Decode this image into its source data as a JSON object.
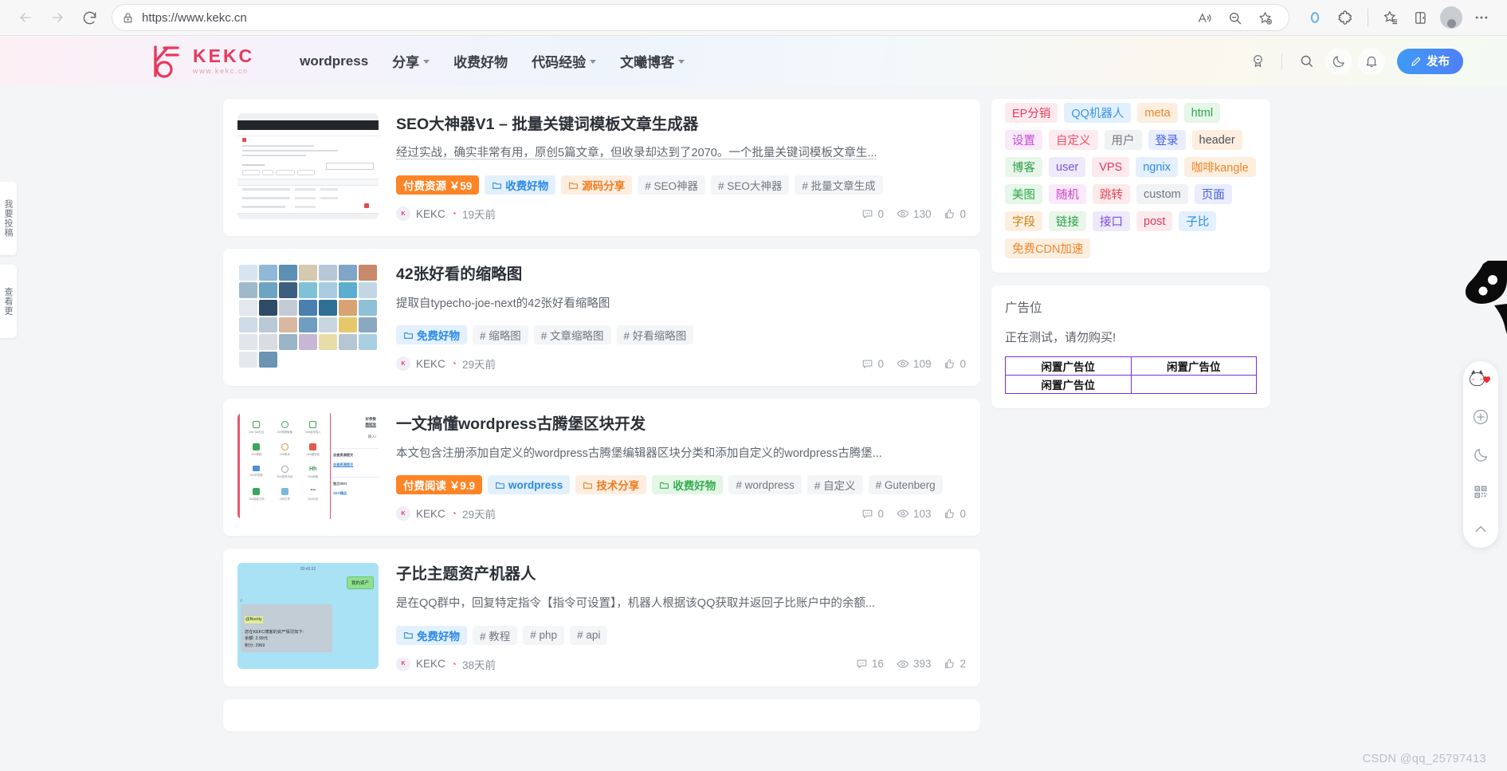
{
  "browser": {
    "url": "https://www.kekc.cn",
    "back_label": "Back",
    "forward_label": "Forward",
    "reload_label": "Refresh",
    "lock_icon": "lock-icon",
    "read_aloud_icon": "read-aloud-icon",
    "zoom_out_icon": "zoom-out-icon",
    "favorite_icon": "add-favorite-icon",
    "browser_essentials_icon": "browser-essentials-icon",
    "extensions_icon": "extensions-icon",
    "collections_icon": "collections-icon",
    "split_screen_icon": "split-screen-icon",
    "profile_icon": "profile-avatar-icon",
    "settings_more_icon": "more-options-icon"
  },
  "site": {
    "logo_word": "KEKC",
    "logo_sub": "www.kekc.cn",
    "nav": [
      {
        "label": "wordpress",
        "has_caret": false
      },
      {
        "label": "分享",
        "has_caret": true
      },
      {
        "label": "收费好物",
        "has_caret": false
      },
      {
        "label": "代码经验",
        "has_caret": true
      },
      {
        "label": "文曦博客",
        "has_caret": true
      }
    ],
    "actions": {
      "medal_icon": "medal-icon",
      "search_icon": "search-icon",
      "dark_mode_icon": "moon-icon",
      "notification_icon": "bell-icon",
      "publish_label": "发布",
      "publish_icon": "pencil-icon",
      "publish_color": "#3e9bf5"
    }
  },
  "posts": [
    {
      "title": "SEO大神器V1 – 批量关键词模板文章生成器",
      "excerpt": "经过实战，确实非常有用，原创5篇文章，但收录却达到了2070。一个批量关键词模板文章生...",
      "excerpt_underline": true,
      "price_tag": "付费资源 ￥59",
      "categories": [
        {
          "label": "收费好物",
          "color": "blue"
        },
        {
          "label": "源码分享",
          "color": "orange"
        }
      ],
      "tags": [
        "# SEO神器",
        "# SEO大神器",
        "# 批量文章生成"
      ],
      "author": "KEKC",
      "time": "19天前",
      "comments": "0",
      "views": "130",
      "likes": "0",
      "thumb": "seo-dashboard-screenshot"
    },
    {
      "title": "42张好看的缩略图",
      "excerpt": "提取自typecho-joe-next的42张好看缩略图",
      "excerpt_underline": false,
      "price_tag": "",
      "categories": [
        {
          "label": "免费好物",
          "color": "blue"
        }
      ],
      "tags": [
        "# 缩略图",
        "# 文章缩略图",
        "# 好看缩略图"
      ],
      "author": "KEKC",
      "time": "29天前",
      "comments": "0",
      "views": "109",
      "likes": "0",
      "thumb": "thumbnail-grid"
    },
    {
      "title": "一文搞懂wordpress古腾堡区块开发",
      "excerpt": "本文包含注册添加自定义的wordpress古腾堡编辑器区块分类和添加自定义的wordpress古腾堡...",
      "excerpt_underline": false,
      "price_tag": "付费阅读 ￥9.9",
      "categories": [
        {
          "label": "wordpress",
          "color": "blue"
        },
        {
          "label": "技术分享",
          "color": "orange"
        },
        {
          "label": "收费好物",
          "color": "green"
        }
      ],
      "tags": [
        "# wordpress",
        "# 自定义",
        "# Gutenberg"
      ],
      "author": "KEKC",
      "time": "29天前",
      "comments": "0",
      "views": "103",
      "likes": "0",
      "thumb": "gutenberg-blocks-screenshot"
    },
    {
      "title": "子比主题资产机器人",
      "excerpt": "是在QQ群中，回复特定指令【指令可设置】，机器人根据该QQ获取并返回子比账户中的余额...",
      "excerpt_underline": false,
      "price_tag": "",
      "categories": [
        {
          "label": "免费好物",
          "color": "blue"
        }
      ],
      "tags": [
        "# 教程",
        "# php",
        "# api"
      ],
      "author": "KEKC",
      "time": "38天前",
      "comments": "16",
      "views": "393",
      "likes": "2",
      "thumb": "qq-chat-screenshot",
      "chat": {
        "time": "20:43:32",
        "out_msg": "我的资产",
        "mention": "@Booliy",
        "line1": "您在KEKC博客的资产情况如下:",
        "line2": "余额: 2.99元",
        "line3": "积分: 2959"
      }
    }
  ],
  "sidebar": {
    "tag_cloud": [
      {
        "label": "EP分销",
        "bg": "#fdeaef",
        "fg": "#e8395c"
      },
      {
        "label": "QQ机器人",
        "bg": "#e2f0fd",
        "fg": "#3b95e8"
      },
      {
        "label": "meta",
        "bg": "#fdeee0",
        "fg": "#f0862a"
      },
      {
        "label": "html",
        "bg": "#e6f6e9",
        "fg": "#2fa84a"
      },
      {
        "label": "设置",
        "bg": "#f9e9fb",
        "fg": "#c34ad6"
      },
      {
        "label": "自定义",
        "bg": "#fdecef",
        "fg": "#ef4f6c"
      },
      {
        "label": "用户",
        "bg": "#f1f2f4",
        "fg": "#72777f"
      },
      {
        "label": "登录",
        "bg": "#e9edfc",
        "fg": "#4461e0"
      },
      {
        "label": "header",
        "bg": "#fdeee0",
        "fg": "#4d5259"
      },
      {
        "label": "博客",
        "bg": "#e8f6ea",
        "fg": "#2b9c45"
      },
      {
        "label": "user",
        "bg": "#efe9fc",
        "fg": "#7b4fdd"
      },
      {
        "label": "VPS",
        "bg": "#fdeaef",
        "fg": "#e1365b"
      },
      {
        "label": "ngnix",
        "bg": "#e4f0fd",
        "fg": "#2e8be6"
      },
      {
        "label": "咖啡kangle",
        "bg": "#fdefe0",
        "fg": "#f0862a"
      },
      {
        "label": "美图",
        "bg": "#e6f6e9",
        "fg": "#2fa84a"
      },
      {
        "label": "随机",
        "bg": "#f9e9fb",
        "fg": "#d03fc2"
      },
      {
        "label": "跳转",
        "bg": "#fdeaea",
        "fg": "#e8445c"
      },
      {
        "label": "custom",
        "bg": "#f1f2f4",
        "fg": "#72777f"
      },
      {
        "label": "页面",
        "bg": "#e9edfc",
        "fg": "#4461e0"
      },
      {
        "label": "字段",
        "bg": "#fdefe0",
        "fg": "#c58118"
      },
      {
        "label": "链接",
        "bg": "#e8f6ea",
        "fg": "#2b9c45"
      },
      {
        "label": "接口",
        "bg": "#efe9fc",
        "fg": "#7b4fdd"
      },
      {
        "label": "post",
        "bg": "#fdeaef",
        "fg": "#e1365b"
      },
      {
        "label": "子比",
        "bg": "#e4f0fd",
        "fg": "#2e8be6"
      },
      {
        "label": "免费CDN加速",
        "bg": "#fdefe0",
        "fg": "#f0862a"
      }
    ],
    "ad_widget": {
      "title": "广告位",
      "note": "正在测试，请勿购买!",
      "cells": [
        [
          "闲置广告位",
          "闲置广告位"
        ],
        [
          "闲置广告位",
          ""
        ]
      ],
      "border_color": "#7b2ed6"
    }
  },
  "side_tabs": [
    {
      "label": "我要投稿"
    },
    {
      "label": "查看更"
    }
  ],
  "float_toolbar": [
    {
      "name": "cat-heart-sticker-icon",
      "label": ""
    },
    {
      "name": "plus-circle-icon",
      "label": ""
    },
    {
      "name": "moon-icon",
      "label": ""
    },
    {
      "name": "qr-code-icon",
      "label": ""
    },
    {
      "name": "chevron-up-icon",
      "label": ""
    }
  ],
  "watermark": "CSDN @qq_25797413"
}
